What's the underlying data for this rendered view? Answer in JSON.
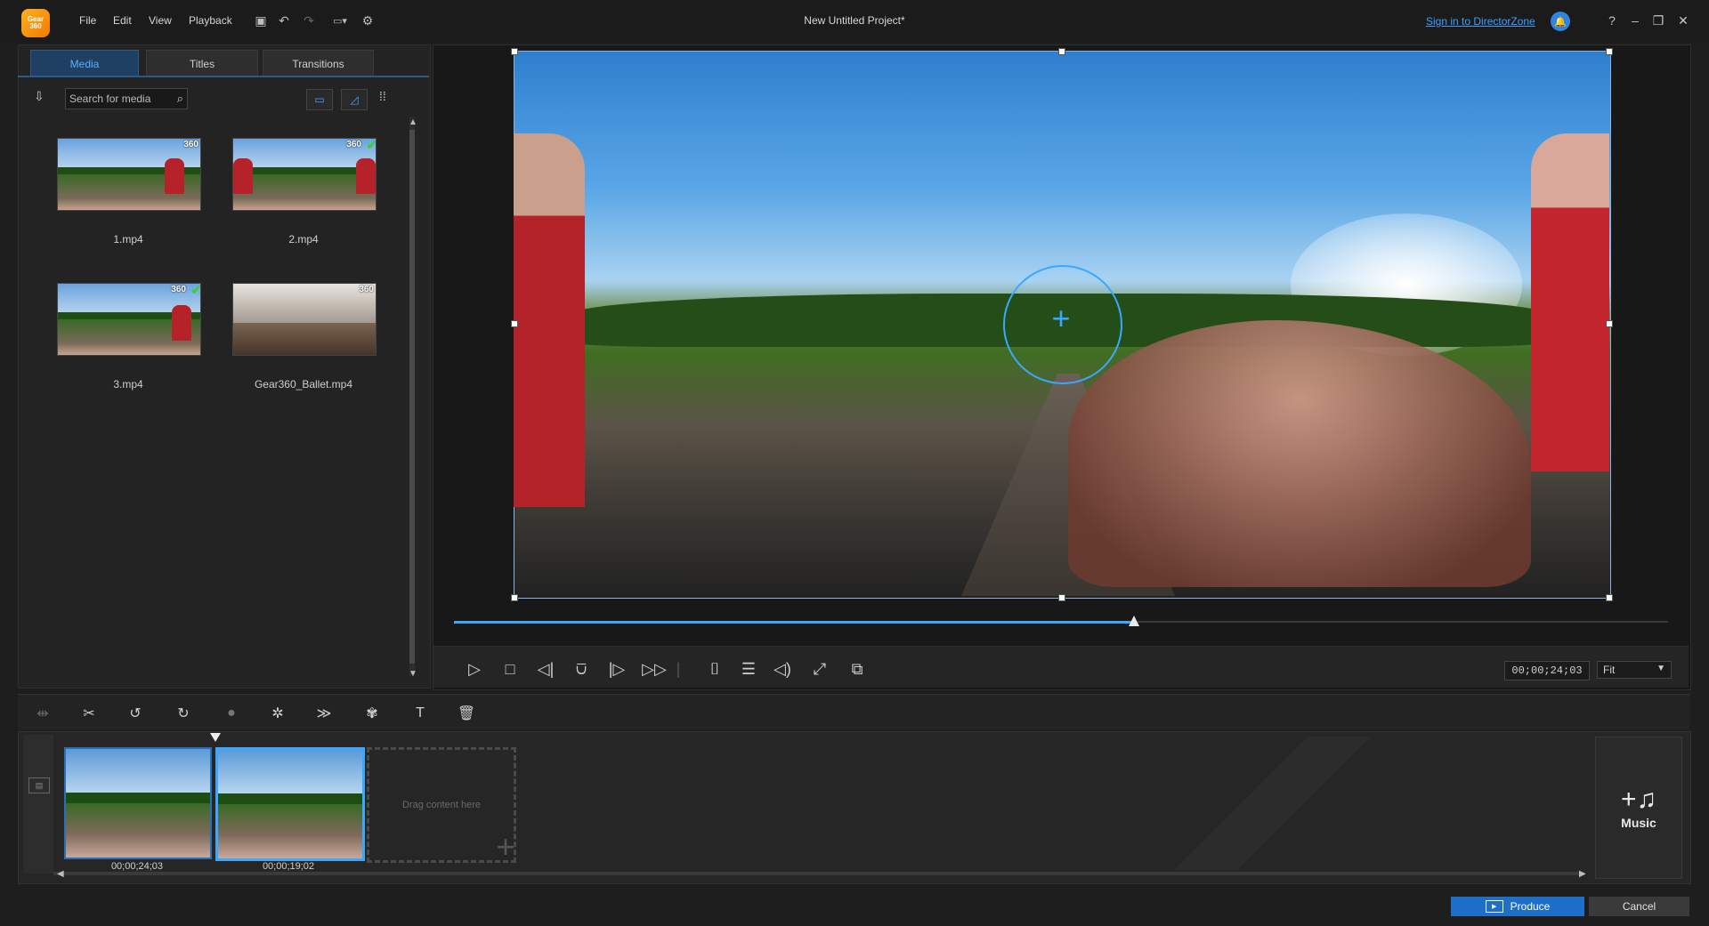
{
  "app": {
    "logo_text": "Gear 360",
    "project_title": "New Untitled Project*",
    "menu": [
      "File",
      "Edit",
      "View",
      "Playback"
    ],
    "sign_in": "Sign in to DirectorZone",
    "toolbar_icons": [
      "save-icon",
      "undo-icon",
      "redo-icon",
      "aspect-ratio-icon",
      "settings-icon"
    ],
    "window_icons": [
      "help-icon",
      "minimize-icon",
      "restore-icon",
      "close-icon"
    ]
  },
  "media_panel": {
    "tabs": [
      {
        "label": "Media",
        "active": true
      },
      {
        "label": "Titles",
        "active": false
      },
      {
        "label": "Transitions",
        "active": false
      }
    ],
    "search_placeholder": "Search for media",
    "items": [
      {
        "name": "1.mp4",
        "badge": "360",
        "checked": false
      },
      {
        "name": "2.mp4",
        "badge": "360",
        "checked": true
      },
      {
        "name": "3.mp4",
        "badge": "360",
        "checked": true
      },
      {
        "name": "Gear360_Ballet.mp4",
        "badge": "360",
        "checked": false
      }
    ]
  },
  "preview": {
    "progress": 0.56,
    "timecode": "00;00;24;03",
    "zoom": "Fit",
    "controls": [
      "play-icon",
      "stop-icon",
      "previous-frame-icon",
      "split-icon",
      "next-frame-icon",
      "fast-forward-icon",
      "snapshot-icon",
      "subtitles-icon",
      "volume-icon",
      "fullscreen-icon",
      "detach-preview-icon"
    ]
  },
  "timeline": {
    "tools": [
      "split-tool-icon",
      "trim-icon",
      "rotate-left-icon",
      "rotate-right-icon",
      "color-icon",
      "magic-icon",
      "speed-icon",
      "effects-icon",
      "title-icon",
      "delete-icon"
    ],
    "clips": [
      {
        "duration": "00;00;24;03",
        "selected": false
      },
      {
        "duration": "00;00;19;02",
        "selected": true
      }
    ],
    "drop_hint": "Drag content here",
    "music_label": "Music"
  },
  "footer": {
    "produce": "Produce",
    "cancel": "Cancel"
  },
  "colors": {
    "accent": "#39a8ff",
    "produce_button": "#1e6fc8",
    "background": "#1e1e1e"
  }
}
